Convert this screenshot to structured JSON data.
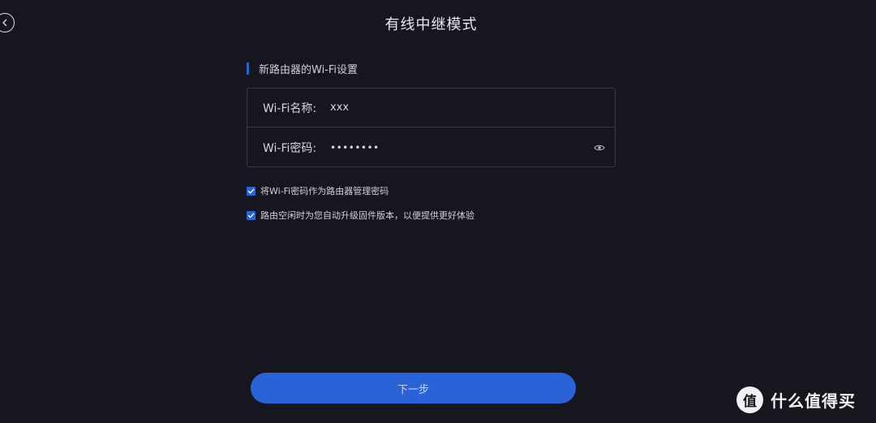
{
  "header": {
    "title": "有线中继模式",
    "back_icon": "chevron-left-circle-icon"
  },
  "section": {
    "title": "新路由器的Wi-Fi设置"
  },
  "form": {
    "name_label": "Wi-Fi名称:",
    "name_value": "xxx",
    "password_label": "Wi-Fi密码:",
    "password_value": "••••••••",
    "eye_icon": "eye-icon"
  },
  "options": [
    {
      "label": "将Wi-Fi密码作为路由器管理密码",
      "checked": true
    },
    {
      "label": "路由空闲时为您自动升级固件版本，以便提供更好体验",
      "checked": true
    }
  ],
  "footer": {
    "next_label": "下一步"
  },
  "watermark": {
    "logo_char": "值",
    "text": "什么值得买"
  },
  "colors": {
    "background": "#16161f",
    "accent": "#2a63d8",
    "border": "#3a3a46"
  }
}
